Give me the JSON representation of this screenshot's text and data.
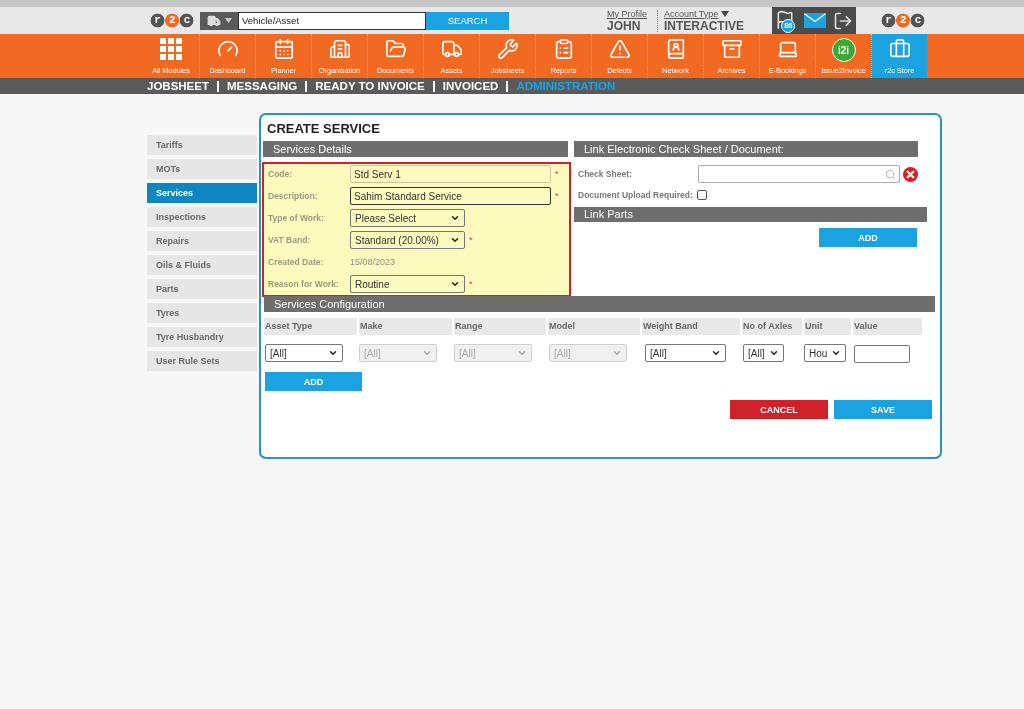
{
  "header": {
    "logo": "r2c",
    "vehicle_search": {
      "value": "Vehicle/Asset",
      "button": "SEARCH"
    },
    "profile": {
      "link": "My Profile",
      "name": "JOHN"
    },
    "account": {
      "link": "Account Type",
      "value": "INTERACTIVE"
    },
    "notifications": {
      "count": "86"
    },
    "brand_logo": "r2c"
  },
  "modules": [
    {
      "label": "All Modules",
      "selected": false
    },
    {
      "label": "Dashboard",
      "selected": false
    },
    {
      "label": "Planner",
      "selected": false
    },
    {
      "label": "Organisation",
      "selected": false
    },
    {
      "label": "Documents",
      "selected": false
    },
    {
      "label": "Assets",
      "selected": false
    },
    {
      "label": "Jobsheets",
      "selected": false
    },
    {
      "label": "Reports",
      "selected": false
    },
    {
      "label": "Defects",
      "selected": false
    },
    {
      "label": "Network",
      "selected": false
    },
    {
      "label": "Archives",
      "selected": false
    },
    {
      "label": "E-Bookings",
      "selected": false
    },
    {
      "label": "Issue2Invoice",
      "badge": "i2i",
      "selected": false
    },
    {
      "label": "r2c Store",
      "selected": true
    }
  ],
  "subnav": [
    {
      "label": "JOBSHEET",
      "selected": false
    },
    {
      "label": "MESSAGING",
      "selected": false
    },
    {
      "label": "READY TO INVOICE",
      "selected": false
    },
    {
      "label": "INVOICED",
      "selected": false
    },
    {
      "label": "ADMINISTRATION",
      "selected": true
    }
  ],
  "sidebar": {
    "items": [
      {
        "label": "Tariffs",
        "selected": false
      },
      {
        "label": "MOTs",
        "selected": false
      },
      {
        "label": "Services",
        "selected": true
      },
      {
        "label": "Inspections",
        "selected": false
      },
      {
        "label": "Repairs",
        "selected": false
      },
      {
        "label": "Oils & Fluids",
        "selected": false
      },
      {
        "label": "Parts",
        "selected": false
      },
      {
        "label": "Tyres",
        "selected": false
      },
      {
        "label": "Tyre Husbandry",
        "selected": false
      },
      {
        "label": "User Rule Sets",
        "selected": false
      }
    ]
  },
  "form": {
    "title": "CREATE SERVICE",
    "details": {
      "heading": "Services Details",
      "highlighted": true,
      "fields": [
        {
          "kind": "text",
          "label": "Code:",
          "value": "Std Serv 1",
          "marker": "*",
          "focused": false
        },
        {
          "kind": "text",
          "label": "Description:",
          "value": "Sahim Standard Service",
          "marker": "*",
          "focused": true
        },
        {
          "kind": "select",
          "label": "Type of Work:",
          "value": "Please Select"
        },
        {
          "kind": "select",
          "label": "VAT Band:",
          "value": "Standard (20.00%)",
          "marker": "*"
        },
        {
          "kind": "static",
          "label": "Created Date:",
          "value": "15/08/2023"
        },
        {
          "kind": "select",
          "label": "Reason for Work:",
          "value": "Routine",
          "marker": "*"
        }
      ]
    },
    "check_sheet_section": {
      "heading": "Link Electronic Check Sheet / Document:",
      "check_sheet": {
        "label": "Check Sheet:"
      },
      "upload_required": {
        "label": "Document Upload Required:",
        "checked": false
      }
    },
    "link_parts": {
      "heading": "Link Parts",
      "button": "ADD"
    },
    "configuration": {
      "heading": "Services Configuration",
      "columns": [
        "Asset Type",
        "Make",
        "Range",
        "Model",
        "Weight Band",
        "No of Axles",
        "Unit",
        "Value"
      ],
      "controls": [
        {
          "kind": "select",
          "value": "[All]",
          "disabled": false
        },
        {
          "kind": "select",
          "value": "[All]",
          "disabled": true
        },
        {
          "kind": "select",
          "value": "[All]",
          "disabled": true
        },
        {
          "kind": "select",
          "value": "[All]",
          "disabled": true
        },
        {
          "kind": "select",
          "value": "[All]",
          "disabled": false
        },
        {
          "kind": "select",
          "value": "[All]",
          "disabled": false
        },
        {
          "kind": "select",
          "value": "Hou",
          "disabled": false
        },
        {
          "kind": "input"
        }
      ],
      "button": "ADD"
    },
    "actions": [
      {
        "kind": "cancel",
        "label": "CANCEL"
      },
      {
        "kind": "save",
        "label": "SAVE"
      }
    ]
  }
}
